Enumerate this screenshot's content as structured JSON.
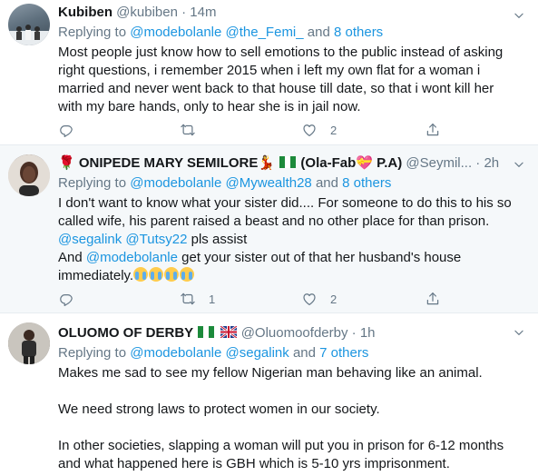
{
  "tweets": [
    {
      "name": "Kubiben",
      "handle": "@kubiben",
      "time": "14m",
      "replying_label": "Replying to",
      "replying_mentions": "@modebolanle @the_Femi_",
      "replying_and": "and",
      "replying_others": "8 others",
      "lines": [
        "Most people just know how to sell emotions to the public instead of asking",
        "right questions, i remember 2015 when i left my own flat for a woman i",
        "married and never went back to that house till date, so that i wont kill her",
        "with my bare hands, only to hear she is in jail now."
      ],
      "replies": "",
      "retweets": "",
      "likes": "2"
    },
    {
      "name": "ONIPEDE MARY SEMILORE",
      "name_suffix": "(Ola-Fab",
      "name_suffix2": "P.A)",
      "handle": "@Seymil...",
      "time": "2h",
      "replying_label": "Replying to",
      "replying_mentions": "@modebolanle @Mywealth28",
      "replying_and": "and",
      "replying_others": "8 others",
      "line1": "I don't want to know what your sister did.... For someone to do this to his so",
      "line2": "called wife, his parent raised a beast and no other place for than prison.",
      "line3_mentions": "@segalink @Tutsy22",
      "line3_rest": " pls assist",
      "line4_and": "And ",
      "line4_mention": "@modebolanle",
      "line4_rest": " get your sister out of that her husband's house",
      "line5": "immediately.",
      "replies": "",
      "retweets": "1",
      "likes": "2"
    },
    {
      "name": "OLUOMO OF DERBY",
      "handle": "@Oluomoofderby",
      "time": "1h",
      "replying_label": "Replying to",
      "replying_mentions": "@modebolanle @segalink",
      "replying_and": "and",
      "replying_others": "7 others",
      "p1": "Makes me sad to see my fellow Nigerian man behaving like an animal.",
      "p2": "We need strong laws to protect women in our society.",
      "p3_line1": "In other societies, slapping a woman will put you in prison for 6-12 months",
      "p3_line2": "and what happened here is GBH which is 5-10 yrs imprisonment."
    }
  ],
  "separator": "·",
  "icons": [
    "chevron-down-icon",
    "reply-icon",
    "retweet-icon",
    "like-icon",
    "share-icon",
    "rose-icon",
    "dancer-icon",
    "nigeria-flag-icon",
    "uk-flag-icon",
    "heart-eyes-icon",
    "crying-face-icon"
  ],
  "colors": {
    "link": "#1b95e0",
    "muted": "#657786",
    "text": "#14171a",
    "highlight_bg": "#f5f8fa"
  }
}
